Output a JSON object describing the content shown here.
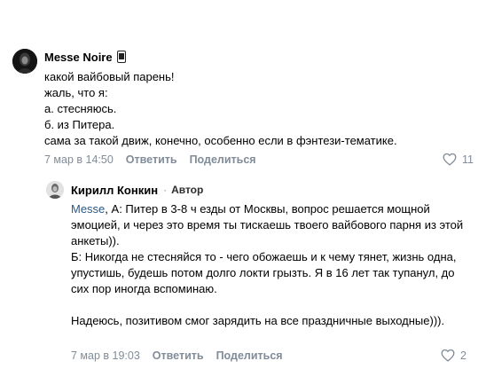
{
  "comments": [
    {
      "author": "Messe Noire",
      "author_emoji": "phone-emoji",
      "lines": [
        "какой вайбовый парень!",
        "жаль, что я:",
        "а. стесняюсь.",
        "б. из Питера.",
        "сама за такой движ, конечно, особенно если в фэнтези-тематике."
      ],
      "date": "7 мар в 14:50",
      "reply_label": "Ответить",
      "share_label": "Поделиться",
      "likes": "11"
    },
    {
      "author": "Кирилл Конкин",
      "separator": "·",
      "badge": "Автор",
      "mention": "Messe",
      "text_after_mention": ", А: Питер в 3-8 ч езды от Москвы, вопрос решается мощной эмоцией, и через это время ты тискаешь твоего вайбового парня из этой анкеты)).\nБ: Никогда не стесняйся то - чего обожаешь и к чему тянет, жизнь одна, упустишь, будешь потом долго локти грызть. Я в 16 лет так тупанул, до сих пор иногда вспоминаю.\n\nНадеюсь, позитивом смог зарядить на все праздничные выходные))).",
      "date": "7 мар в 19:03",
      "reply_label": "Ответить",
      "share_label": "Поделиться",
      "likes": "2"
    }
  ],
  "colors": {
    "link": "#2a5885",
    "meta": "#818c99"
  }
}
